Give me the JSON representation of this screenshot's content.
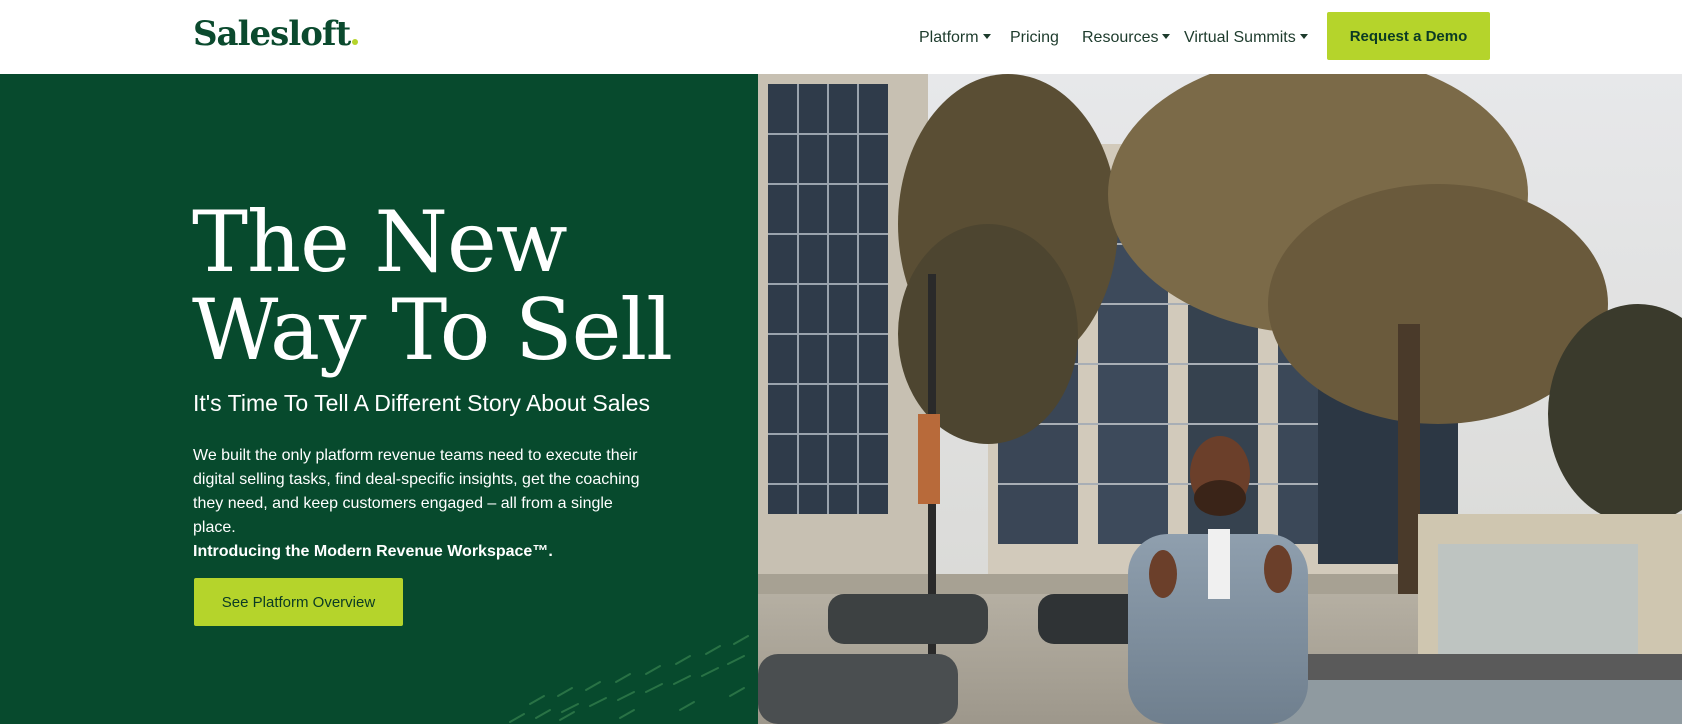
{
  "header": {
    "logo_text": "Salesloft",
    "nav": [
      {
        "label": "Platform",
        "dropdown": true
      },
      {
        "label": "Pricing",
        "dropdown": false
      },
      {
        "label": "Resources",
        "dropdown": true
      },
      {
        "label": "Virtual Summits",
        "dropdown": true
      }
    ],
    "cta_label": "Request a Demo"
  },
  "hero": {
    "title_line1": "The New",
    "title_line2": "Way To Sell",
    "subtitle": "It's Time To Tell A Different Story About Sales",
    "body": "We built the only platform revenue teams need to execute their digital selling tasks, find deal-specific insights, get the coaching they need, and keep customers engaged – all from a single place.",
    "body_strong": "Introducing the Modern Revenue Workspace™.",
    "button_label": "See Platform Overview"
  },
  "colors": {
    "brand_green": "#074a2d",
    "accent_lime": "#b5d42b",
    "nav_text": "#1d3b2c"
  },
  "icons": {
    "nav_dropdown": "caret-down-icon",
    "hero_video": "video-still"
  }
}
